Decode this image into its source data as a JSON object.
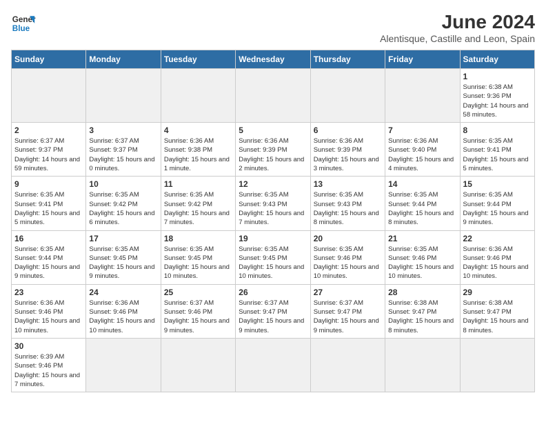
{
  "header": {
    "logo_text_general": "General",
    "logo_text_blue": "Blue",
    "title": "June 2024",
    "subtitle": "Alentisque, Castille and Leon, Spain"
  },
  "days_of_week": [
    "Sunday",
    "Monday",
    "Tuesday",
    "Wednesday",
    "Thursday",
    "Friday",
    "Saturday"
  ],
  "weeks": [
    [
      {
        "day": "",
        "info": ""
      },
      {
        "day": "",
        "info": ""
      },
      {
        "day": "",
        "info": ""
      },
      {
        "day": "",
        "info": ""
      },
      {
        "day": "",
        "info": ""
      },
      {
        "day": "",
        "info": ""
      },
      {
        "day": "1",
        "info": "Sunrise: 6:38 AM\nSunset: 9:36 PM\nDaylight: 14 hours and 58 minutes."
      }
    ],
    [
      {
        "day": "2",
        "info": "Sunrise: 6:37 AM\nSunset: 9:37 PM\nDaylight: 14 hours and 59 minutes."
      },
      {
        "day": "3",
        "info": "Sunrise: 6:37 AM\nSunset: 9:37 PM\nDaylight: 15 hours and 0 minutes."
      },
      {
        "day": "4",
        "info": "Sunrise: 6:36 AM\nSunset: 9:38 PM\nDaylight: 15 hours and 1 minute."
      },
      {
        "day": "5",
        "info": "Sunrise: 6:36 AM\nSunset: 9:39 PM\nDaylight: 15 hours and 2 minutes."
      },
      {
        "day": "6",
        "info": "Sunrise: 6:36 AM\nSunset: 9:39 PM\nDaylight: 15 hours and 3 minutes."
      },
      {
        "day": "7",
        "info": "Sunrise: 6:36 AM\nSunset: 9:40 PM\nDaylight: 15 hours and 4 minutes."
      },
      {
        "day": "8",
        "info": "Sunrise: 6:35 AM\nSunset: 9:41 PM\nDaylight: 15 hours and 5 minutes."
      }
    ],
    [
      {
        "day": "9",
        "info": "Sunrise: 6:35 AM\nSunset: 9:41 PM\nDaylight: 15 hours and 5 minutes."
      },
      {
        "day": "10",
        "info": "Sunrise: 6:35 AM\nSunset: 9:42 PM\nDaylight: 15 hours and 6 minutes."
      },
      {
        "day": "11",
        "info": "Sunrise: 6:35 AM\nSunset: 9:42 PM\nDaylight: 15 hours and 7 minutes."
      },
      {
        "day": "12",
        "info": "Sunrise: 6:35 AM\nSunset: 9:43 PM\nDaylight: 15 hours and 7 minutes."
      },
      {
        "day": "13",
        "info": "Sunrise: 6:35 AM\nSunset: 9:43 PM\nDaylight: 15 hours and 8 minutes."
      },
      {
        "day": "14",
        "info": "Sunrise: 6:35 AM\nSunset: 9:44 PM\nDaylight: 15 hours and 8 minutes."
      },
      {
        "day": "15",
        "info": "Sunrise: 6:35 AM\nSunset: 9:44 PM\nDaylight: 15 hours and 9 minutes."
      }
    ],
    [
      {
        "day": "16",
        "info": "Sunrise: 6:35 AM\nSunset: 9:44 PM\nDaylight: 15 hours and 9 minutes."
      },
      {
        "day": "17",
        "info": "Sunrise: 6:35 AM\nSunset: 9:45 PM\nDaylight: 15 hours and 9 minutes."
      },
      {
        "day": "18",
        "info": "Sunrise: 6:35 AM\nSunset: 9:45 PM\nDaylight: 15 hours and 10 minutes."
      },
      {
        "day": "19",
        "info": "Sunrise: 6:35 AM\nSunset: 9:45 PM\nDaylight: 15 hours and 10 minutes."
      },
      {
        "day": "20",
        "info": "Sunrise: 6:35 AM\nSunset: 9:46 PM\nDaylight: 15 hours and 10 minutes."
      },
      {
        "day": "21",
        "info": "Sunrise: 6:35 AM\nSunset: 9:46 PM\nDaylight: 15 hours and 10 minutes."
      },
      {
        "day": "22",
        "info": "Sunrise: 6:36 AM\nSunset: 9:46 PM\nDaylight: 15 hours and 10 minutes."
      }
    ],
    [
      {
        "day": "23",
        "info": "Sunrise: 6:36 AM\nSunset: 9:46 PM\nDaylight: 15 hours and 10 minutes."
      },
      {
        "day": "24",
        "info": "Sunrise: 6:36 AM\nSunset: 9:46 PM\nDaylight: 15 hours and 10 minutes."
      },
      {
        "day": "25",
        "info": "Sunrise: 6:37 AM\nSunset: 9:46 PM\nDaylight: 15 hours and 9 minutes."
      },
      {
        "day": "26",
        "info": "Sunrise: 6:37 AM\nSunset: 9:47 PM\nDaylight: 15 hours and 9 minutes."
      },
      {
        "day": "27",
        "info": "Sunrise: 6:37 AM\nSunset: 9:47 PM\nDaylight: 15 hours and 9 minutes."
      },
      {
        "day": "28",
        "info": "Sunrise: 6:38 AM\nSunset: 9:47 PM\nDaylight: 15 hours and 8 minutes."
      },
      {
        "day": "29",
        "info": "Sunrise: 6:38 AM\nSunset: 9:47 PM\nDaylight: 15 hours and 8 minutes."
      }
    ],
    [
      {
        "day": "30",
        "info": "Sunrise: 6:39 AM\nSunset: 9:46 PM\nDaylight: 15 hours and 7 minutes."
      },
      {
        "day": "",
        "info": ""
      },
      {
        "day": "",
        "info": ""
      },
      {
        "day": "",
        "info": ""
      },
      {
        "day": "",
        "info": ""
      },
      {
        "day": "",
        "info": ""
      },
      {
        "day": "",
        "info": ""
      }
    ]
  ]
}
